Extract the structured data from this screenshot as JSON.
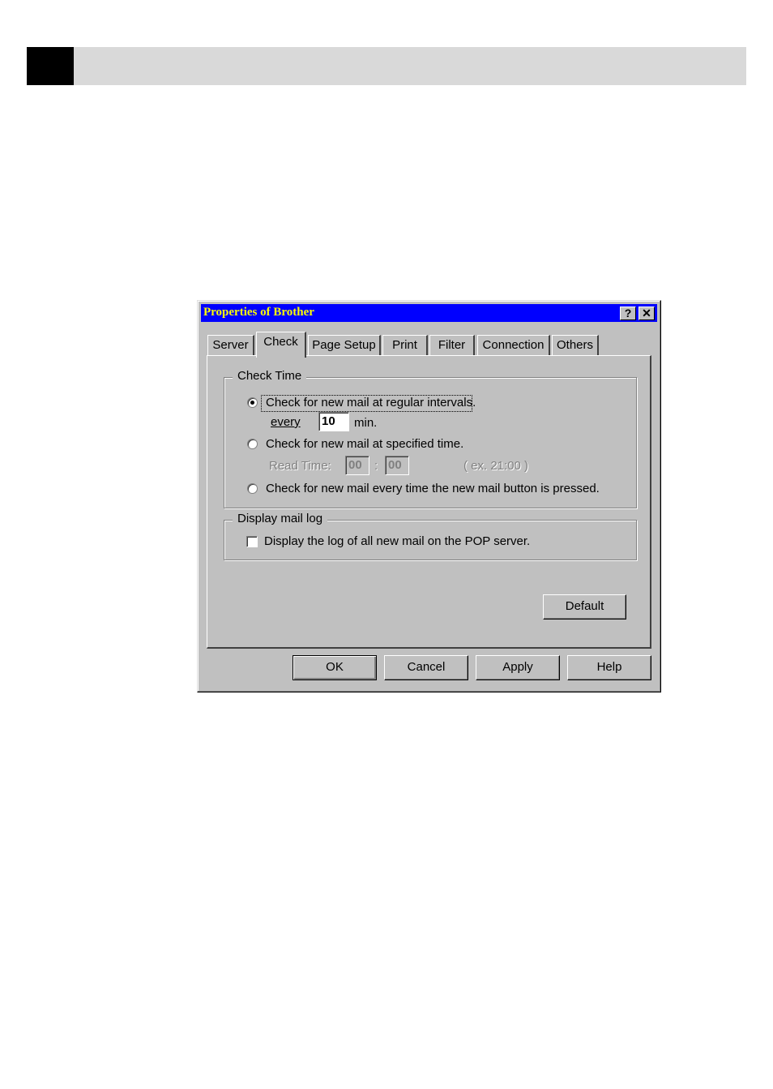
{
  "dialog": {
    "title": "Properties of Brother",
    "help_button": "?",
    "close_button": "✕"
  },
  "tabs": [
    {
      "label": "Server"
    },
    {
      "label": "Check",
      "active": true
    },
    {
      "label": "Page Setup"
    },
    {
      "label": "Print"
    },
    {
      "label": "Filter"
    },
    {
      "label": "Connection"
    },
    {
      "label": "Others"
    }
  ],
  "check_time": {
    "legend": "Check Time",
    "option_intervals": "Check for new mail at regular intervals.",
    "every_label": "every",
    "interval_value": "10",
    "min_label": "min.",
    "option_specified": "Check for new mail at specified time.",
    "read_time_label": "Read Time:",
    "hour_value": "00",
    "colon": ":",
    "minute_value": "00",
    "example": "( ex. 21:00 )",
    "option_button": "Check for new mail every time the new mail button is pressed.",
    "selected": "intervals"
  },
  "mail_log": {
    "legend": "Display mail log",
    "checkbox_label": "Display the log of all new mail on the POP server.",
    "checked": false
  },
  "buttons": {
    "default": "Default",
    "ok": "OK",
    "cancel": "Cancel",
    "apply": "Apply",
    "help": "Help"
  }
}
